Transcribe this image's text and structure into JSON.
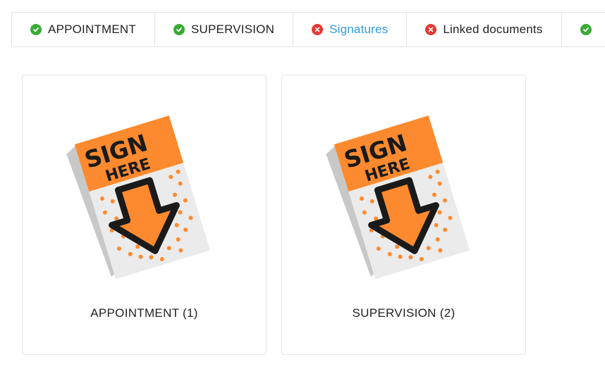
{
  "tabs": [
    {
      "label": "APPOINTMENT",
      "status": "complete",
      "icon": "check-circle-icon"
    },
    {
      "label": "SUPERVISION",
      "status": "complete",
      "icon": "check-circle-icon"
    },
    {
      "label": "Signatures",
      "status": "incomplete",
      "icon": "x-circle-icon",
      "active": true
    },
    {
      "label": "Linked documents",
      "status": "incomplete",
      "icon": "x-circle-icon"
    },
    {
      "label": "",
      "status": "complete",
      "icon": "check-circle-icon"
    }
  ],
  "cards": [
    {
      "label": "APPOINTMENT (1)",
      "image_text": "SIGN HERE",
      "icon": "sign-here-document-icon"
    },
    {
      "label": "SUPERVISION (2)",
      "image_text": "SIGN HERE",
      "icon": "sign-here-document-icon"
    }
  ],
  "colors": {
    "accent": "#2f9be8",
    "success": "#3aaa35",
    "error": "#e53935",
    "sign_orange": "#fd8a2e"
  }
}
